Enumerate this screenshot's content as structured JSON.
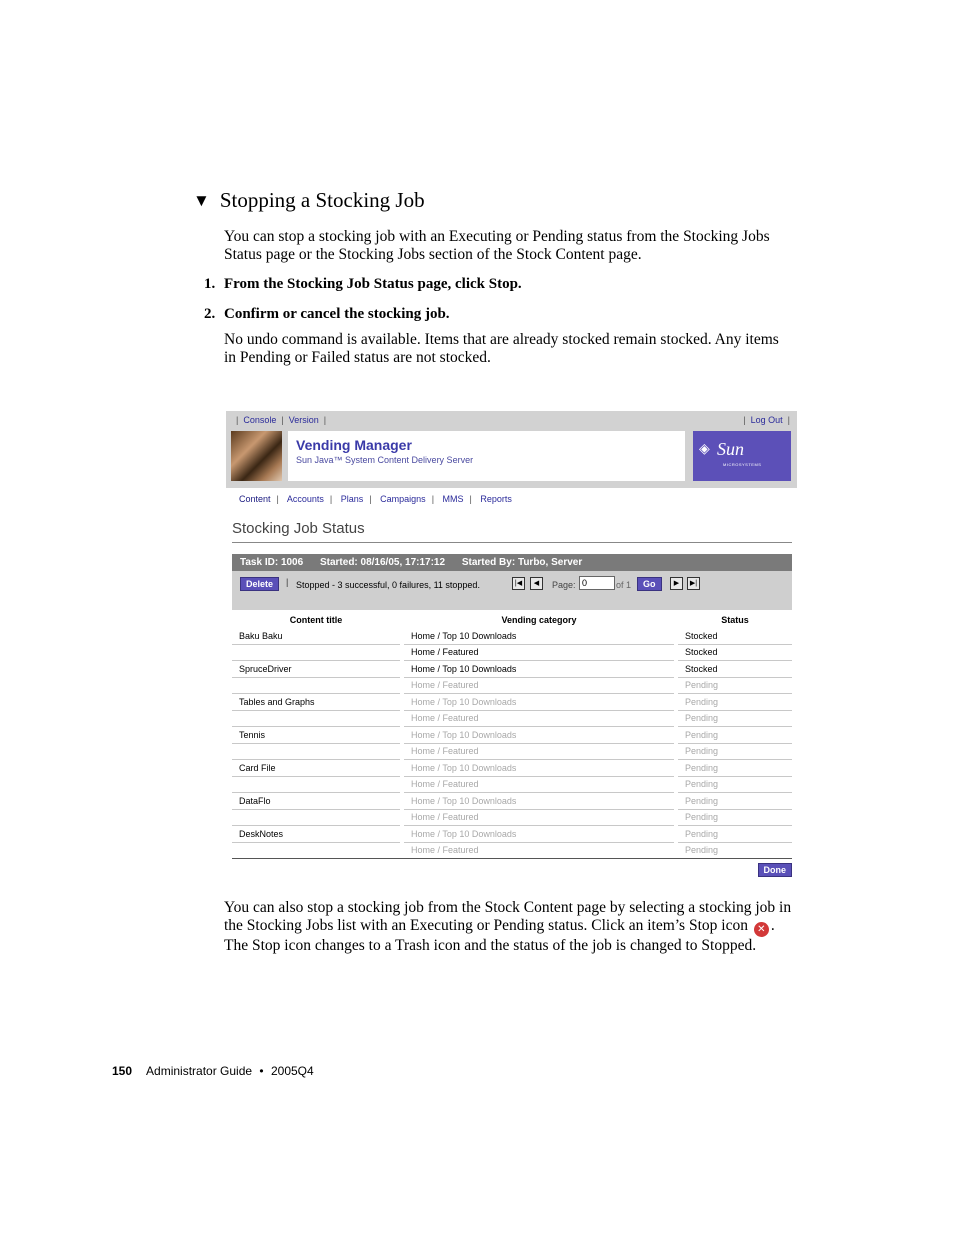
{
  "heading": {
    "marker": "▼",
    "text": "Stopping a Stocking Job"
  },
  "intro": "You can stop a stocking job with an Executing or Pending status from the Stocking Jobs Status page or the Stocking Jobs section of the Stock Content page.",
  "steps": [
    {
      "num": "1.",
      "text": "From the Stocking Job Status page, click Stop."
    },
    {
      "num": "2.",
      "text": "Confirm or cancel the stocking job."
    }
  ],
  "note": "No undo command is available. Items that are already stocked remain stocked. Any items in Pending or Failed status are not stocked.",
  "ui": {
    "top_links": [
      "Console",
      "Version"
    ],
    "logout": "Log Out",
    "app_title": "Vending Manager",
    "app_subtitle": "Sun Java™ System Content Delivery Server",
    "sun_logo": "Sun",
    "sun_small": "MICROSYSTEMS",
    "nav": [
      "Content",
      "Accounts",
      "Plans",
      "Campaigns",
      "MMS",
      "Reports"
    ],
    "page_title": "Stocking Job Status",
    "task_id": "Task ID: 1006",
    "started": "Started: 08/16/05, 17:17:12",
    "started_by": "Started By: Turbo, Server",
    "delete_label": "Delete",
    "stopped_text": "Stopped - 3 successful, 0 failures, 11 stopped.",
    "page_label": "Page:",
    "page_value": "0",
    "page_of": "of 1",
    "go_label": "Go",
    "done_label": "Done",
    "columns": [
      "Content title",
      "Vending category",
      "Status"
    ],
    "rows": [
      {
        "title": "Baku Baku",
        "category": "Home / Top 10 Downloads",
        "status": "Stocked"
      },
      {
        "title": "",
        "category": "Home / Featured",
        "status": "Stocked"
      },
      {
        "title": "SpruceDriver",
        "category": "Home / Top 10 Downloads",
        "status": "Stocked"
      },
      {
        "title": "",
        "category": "Home / Featured",
        "status": "Pending"
      },
      {
        "title": "Tables and Graphs",
        "category": "Home / Top 10 Downloads",
        "status": "Pending"
      },
      {
        "title": "",
        "category": "Home / Featured",
        "status": "Pending"
      },
      {
        "title": "Tennis",
        "category": "Home / Top 10 Downloads",
        "status": "Pending"
      },
      {
        "title": "",
        "category": "Home / Featured",
        "status": "Pending"
      },
      {
        "title": "Card File",
        "category": "Home / Top 10 Downloads",
        "status": "Pending"
      },
      {
        "title": "",
        "category": "Home / Featured",
        "status": "Pending"
      },
      {
        "title": "DataFlo",
        "category": "Home / Top 10 Downloads",
        "status": "Pending"
      },
      {
        "title": "",
        "category": "Home / Featured",
        "status": "Pending"
      },
      {
        "title": "DeskNotes",
        "category": "Home / Top 10 Downloads",
        "status": "Pending"
      },
      {
        "title": "",
        "category": "Home / Featured",
        "status": "Pending"
      }
    ]
  },
  "closing": {
    "part1": "You can also stop a stocking job from the Stock Content page by selecting a stocking job in the Stocking Jobs list with an Executing or Pending status. Click an item’s Stop icon",
    "part2": ". The Stop icon changes to a Trash icon and the status of the job is changed to Stopped."
  },
  "footer": {
    "page_number": "150",
    "guide": "Administrator Guide",
    "bullet": "•",
    "version": "2005Q4"
  }
}
